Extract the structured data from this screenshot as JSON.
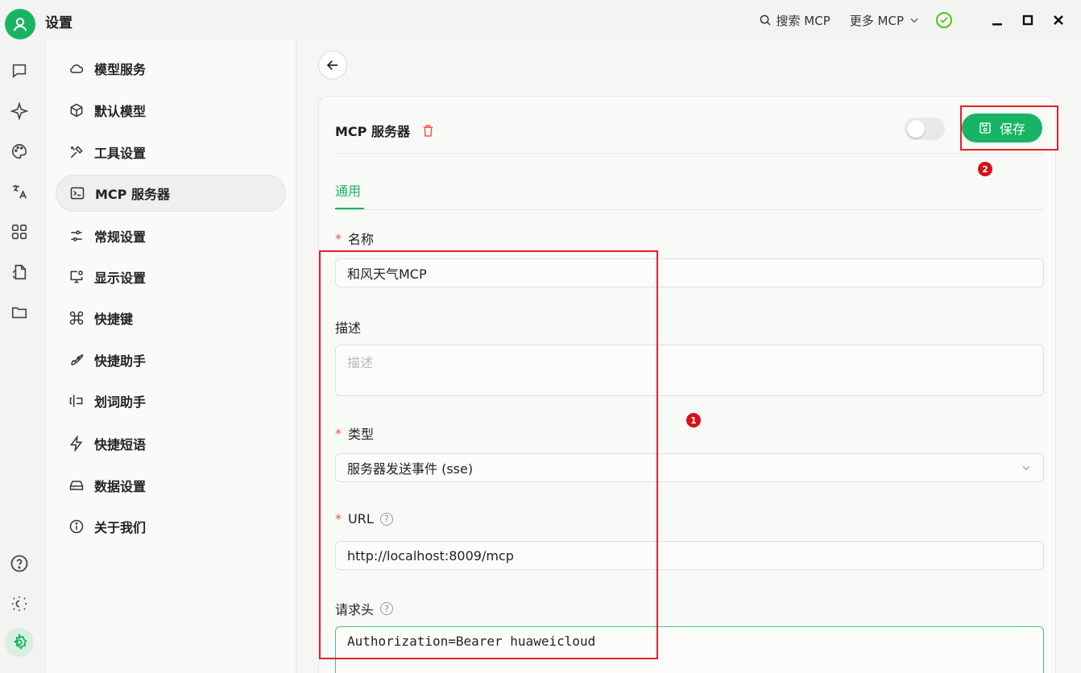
{
  "titlebar": {
    "title": "设置",
    "search_mcp": "搜索 MCP",
    "more_mcp": "更多 MCP"
  },
  "nav": {
    "items": [
      {
        "label": "模型服务",
        "icon": "cloud-icon"
      },
      {
        "label": "默认模型",
        "icon": "cube-icon"
      },
      {
        "label": "工具设置",
        "icon": "tools-icon"
      },
      {
        "label": "MCP 服务器",
        "icon": "terminal-icon",
        "active": true
      },
      {
        "label": "常规设置",
        "icon": "sliders-icon"
      },
      {
        "label": "显示设置",
        "icon": "monitor-icon"
      },
      {
        "label": "快捷键",
        "icon": "command-icon"
      },
      {
        "label": "快捷助手",
        "icon": "rocket-icon"
      },
      {
        "label": "划词助手",
        "icon": "text-select-icon"
      },
      {
        "label": "快捷短语",
        "icon": "zap-icon"
      },
      {
        "label": "数据设置",
        "icon": "drive-icon"
      },
      {
        "label": "关于我们",
        "icon": "info-icon"
      }
    ]
  },
  "card": {
    "title": "MCP 服务器",
    "save_label": "保存",
    "tab_general": "通用",
    "name_label": "名称",
    "name_value": "和风天气MCP",
    "desc_label": "描述",
    "desc_placeholder": "描述",
    "type_label": "类型",
    "type_value": "服务器发送事件 (sse)",
    "url_label": "URL",
    "url_value": "http://localhost:8009/mcp",
    "headers_label": "请求头",
    "headers_value": "Authorization=Bearer huaweicloud",
    "required_mark": "*",
    "help_mark": "?"
  },
  "annotations": {
    "badge1": "1",
    "badge2": "2"
  },
  "colors": {
    "accent": "#17b466",
    "annotation": "#e5202a",
    "danger": "#ff4d4f"
  }
}
